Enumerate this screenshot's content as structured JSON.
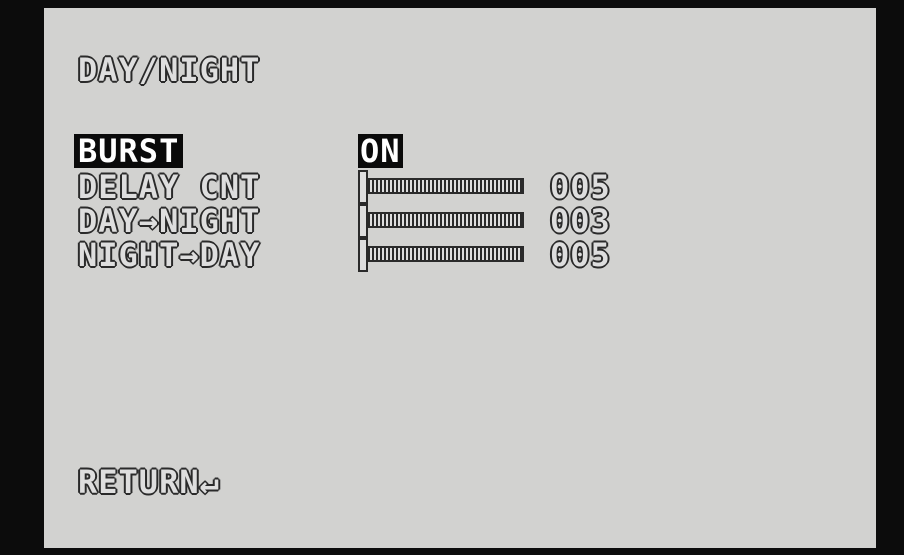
{
  "menu": {
    "title": "DAY/NIGHT",
    "items": [
      {
        "label": "BURST",
        "value": "ON",
        "type": "toggle",
        "selected": true
      },
      {
        "label": "DELAY CNT",
        "value": "005",
        "type": "slider",
        "level": 0.0,
        "selected": false
      },
      {
        "label": "DAY→NIGHT",
        "value": "003",
        "type": "slider",
        "level": 0.0,
        "selected": false
      },
      {
        "label": "NIGHT→DAY",
        "value": "005",
        "type": "slider",
        "level": 0.0,
        "selected": false
      }
    ],
    "return_label": "RETURN↵"
  },
  "colors": {
    "background": "#d2d2d0",
    "bezel": "#0c0c0c",
    "text": "#dedede",
    "outline": "#2a2a2a",
    "highlight": "#0a0a0a"
  }
}
